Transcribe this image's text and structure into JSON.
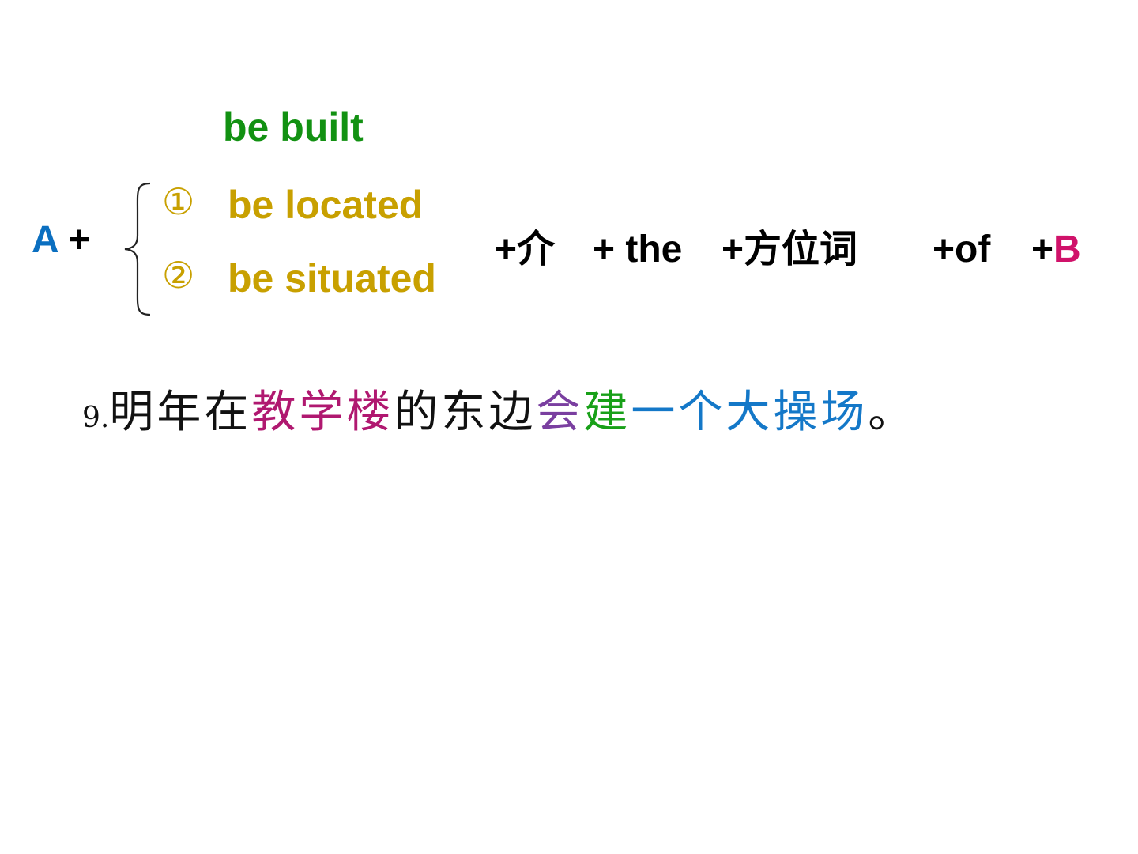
{
  "colors": {
    "green": "#129112",
    "gold": "#c8a000",
    "blue": "#0b6fc0",
    "magenta": "#d0126a",
    "purple": "#7a3fa0",
    "sentence_green": "#18a018",
    "sentence_blue": "#1478c8"
  },
  "top_phrase": "be built",
  "left_term": {
    "letter": "A",
    "plus": " +"
  },
  "options": [
    {
      "marker": "①",
      "text": "be located"
    },
    {
      "marker": "②",
      "text": "be situated"
    }
  ],
  "formula": {
    "prep": "+介",
    "the": "+ the",
    "fangweici": "+方位词",
    "of": "+of",
    "b_plus": "+",
    "b_letter": "B"
  },
  "sentence": {
    "number": "9.",
    "seg1": "明年在",
    "seg2": "教学楼",
    "seg3": "的东边",
    "seg4": "会",
    "seg5": "建",
    "seg6": "一个大操场",
    "seg7": "。"
  }
}
